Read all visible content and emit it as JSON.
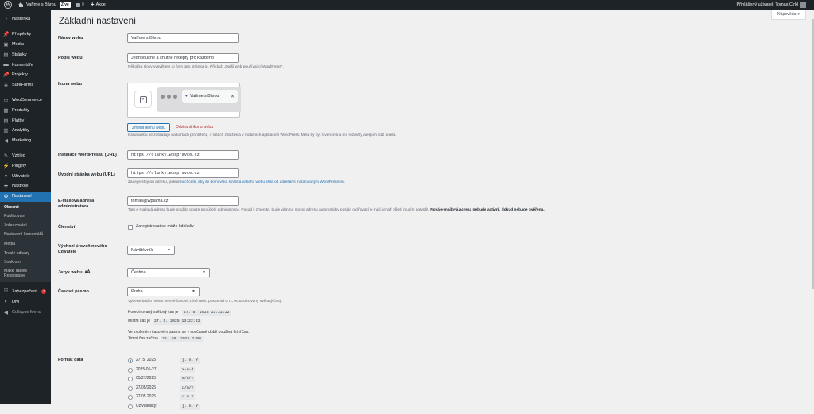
{
  "adminbar": {
    "site_name": "Vaříme s Bárou",
    "live_badge": "Živé",
    "comments_count": "0",
    "new_label": "Akce",
    "user_greeting": "Přihlášený uživatel: Tomas Cirkl"
  },
  "sidebar": {
    "items_top": [
      {
        "label": "Nástěnka",
        "icon": "dashboard-icon"
      }
    ],
    "items_content": [
      {
        "label": "Příspěvky",
        "icon": "pin-icon"
      },
      {
        "label": "Média",
        "icon": "media-icon"
      },
      {
        "label": "Stránky",
        "icon": "page-icon"
      },
      {
        "label": "Komentáře",
        "icon": "comment-icon"
      },
      {
        "label": "Projekty",
        "icon": "pin-icon"
      },
      {
        "label": "SureForms",
        "icon": "sureforms-icon"
      }
    ],
    "items_shop": [
      {
        "label": "WooCommerce",
        "icon": "woo-icon"
      },
      {
        "label": "Produkty",
        "icon": "product-icon"
      },
      {
        "label": "Platby",
        "icon": "payments-icon"
      },
      {
        "label": "Analytiky",
        "icon": "analytics-icon"
      },
      {
        "label": "Marketing",
        "icon": "megaphone-icon"
      }
    ],
    "items_settings": [
      {
        "label": "Vzhled",
        "icon": "brush-icon"
      },
      {
        "label": "Pluginy",
        "icon": "plugin-icon"
      },
      {
        "label": "Uživatelé",
        "icon": "user-icon"
      },
      {
        "label": "Nástroje",
        "icon": "wrench-icon"
      }
    ],
    "current": {
      "label": "Nastavení",
      "icon": "sliders-icon"
    },
    "submenu": [
      "Obecné",
      "Publikování",
      "Zobrazování",
      "Nastavení komentářů",
      "Média",
      "Trvalé odkazy",
      "Soukromí",
      "Make Tables Responsive"
    ],
    "security": {
      "label": "Zabezpečení",
      "badge": "1"
    },
    "divi": "Divi",
    "collapse": "Collapse Menu"
  },
  "help_tab": "Nápověda",
  "page_title": "Základní nastavení",
  "form": {
    "site_title": {
      "label": "Název webu",
      "value": "Vaříme s Bárou"
    },
    "tagline": {
      "label": "Popis webu",
      "value": "Jednoduché a chutné recepty pro každého",
      "desc": "Několika slovy vysvětlete, o čem tato stránka je. Příklad: „Další web používající WordPress“."
    },
    "site_icon": {
      "label": "Ikona webu",
      "tab_title": "Vaříme s Bárou",
      "change_button": "Změnit ikonu webu",
      "remove_link": "Odstranit ikonu webu",
      "desc": "Ikona webu se zobrazuje na kartách prohlížeče, v lištách záložek a v mobilních aplikacích WordPress. Měla by být čtvercová a mít rozměry alespoň 512 pixelů."
    },
    "wp_address": {
      "label": "Instalace WordPressu (URL)",
      "value": "https://clanky.wpspravce.cz"
    },
    "site_address": {
      "label": "Úvodní stránka webu (URL)",
      "value": "https://clanky.wpspravce.cz",
      "desc_before": "Zadejte stejnou adresu, pokud ",
      "desc_link": "nechcete, aby se domovská stránka vašeho webu lišila od adresář s instalovaným WordPressem",
      "desc_after": "."
    },
    "admin_email": {
      "label": "E-mailová adresa administrátora",
      "value": "tomas@wplama.cz",
      "desc": "Tato e-mailová adresa bude použita pouze pro účely administrace. Pokud ji změníte, bude vám na novou adresu automaticky poslán ověřovací e-mail, jehož přijetí musíte potvrdit.",
      "desc_bold": "Nová e-mailová adresa nebude aktivní, dokud nebude ověřena."
    },
    "membership": {
      "label": "Členství",
      "checkbox_label": "Zaregistrovat se může kdokoliv"
    },
    "default_role": {
      "label": "Výchozí úroveň nového uživatele",
      "value": "Návštěvník"
    },
    "language": {
      "label": "Jazyk webu",
      "value": "Čeština",
      "icon": "translation-icon"
    },
    "timezone": {
      "label": "Časové pásmo",
      "value": "Praha",
      "desc": "Vyberte buďto město ve své časové zóně nebo posun od UTC (Koordinovaný světový čas).",
      "utc_label": "Koordinovaný světový čas je",
      "utc_value": "27. 5. 2025 11:22:22",
      "local_label": "Místní čas je",
      "local_value": "27. 5. 2025 13:22:22",
      "dst_note": "Ve zvoleném časovém pásmu se v současné době používá letní čas.",
      "winter_label": "Zimní čas začíná",
      "winter_value": "26. 10. 2025 2:00"
    },
    "date_format": {
      "label": "Formát data",
      "options": [
        {
          "example": "27. 5. 2025",
          "code": "j. n. Y",
          "checked": true
        },
        {
          "example": "2025-05-27",
          "code": "Y-m-d",
          "checked": false
        },
        {
          "example": "05/27/2025",
          "code": "m/d/Y",
          "checked": false
        },
        {
          "example": "27/05/2025",
          "code": "d/m/Y",
          "checked": false
        },
        {
          "example": "27.05.2025",
          "code": "d.m.Y",
          "checked": false
        },
        {
          "example": "Uživatelský:",
          "code": "j. n. Y",
          "checked": false
        }
      ]
    }
  }
}
